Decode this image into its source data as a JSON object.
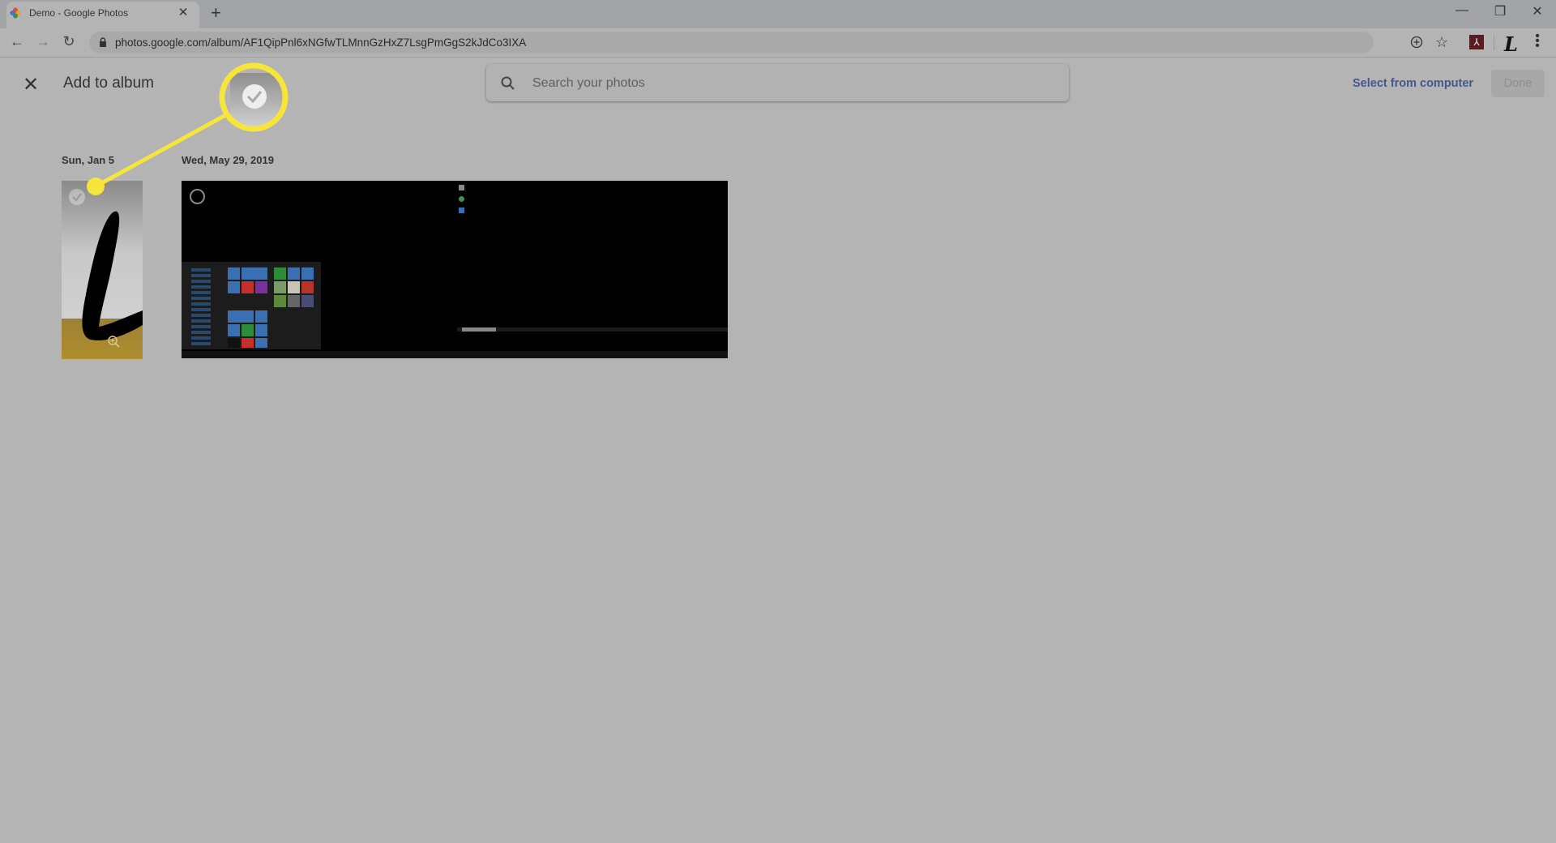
{
  "browser": {
    "tab_title": "Demo - Google Photos",
    "tab_close": "✕",
    "new_tab": "+",
    "url": "photos.google.com/album/AF1QipPnl6xNGfwTLMnnGzHxZ7LsgPmGgS2kJdCo3IXA",
    "window_controls": {
      "minimize": "—",
      "restore": "❐",
      "close": "✕"
    },
    "nav": {
      "back": "←",
      "forward": "→",
      "reload": "↻"
    },
    "bookmark_star": "☆",
    "pdf_extension": "⅄",
    "profile_glyph": "L",
    "menu": "⋮"
  },
  "page": {
    "close": "✕",
    "title": "Add to album",
    "search": {
      "placeholder": "Search your photos",
      "value": ""
    },
    "select_from_computer": "Select from computer",
    "done": "Done"
  },
  "groups": [
    {
      "date": "Sun, Jan 5",
      "photos": [
        {
          "description": "Handwritten L logo on gold background",
          "selected": false
        }
      ]
    },
    {
      "date": "Wed, May 29, 2019",
      "photos": [
        {
          "description": "Windows 10 desktop screenshot with Start menu",
          "selected": false
        }
      ]
    }
  ],
  "annotation": {
    "color": "#f7e53b",
    "target": "photo selection checkmark"
  },
  "colors": {
    "background": "#b4b4b4",
    "link": "#41598c",
    "callout": "#f7e53b"
  }
}
